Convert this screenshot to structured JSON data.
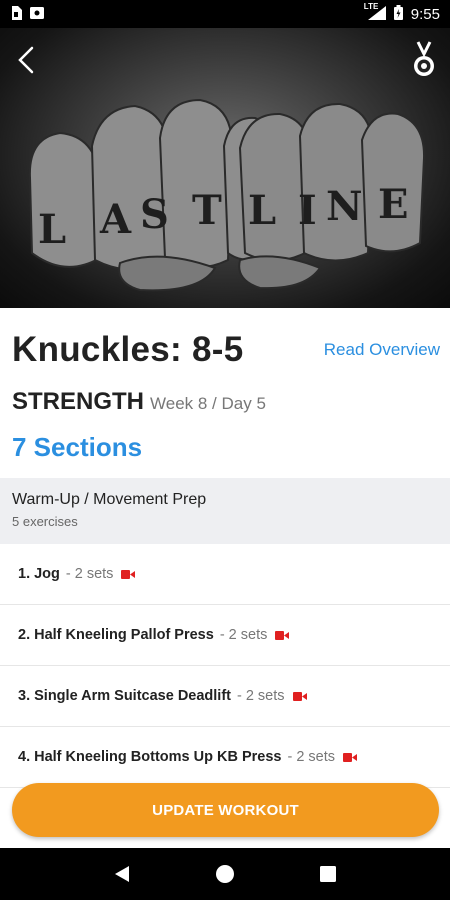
{
  "status_bar": {
    "time": "9:55",
    "network": "LTE",
    "icons": [
      "sim-card-icon",
      "storage-icon",
      "signal-icon",
      "battery-icon"
    ]
  },
  "hero": {
    "image_text": "LASTLINE",
    "back_icon": "chevron-left-icon",
    "medal_icon": "medal-icon"
  },
  "workout": {
    "title": "Knuckles: 8-5",
    "read_overview": "Read Overview",
    "category": "STRENGTH",
    "week_day": "Week 8 / Day 5",
    "sections_count": "7 Sections"
  },
  "section": {
    "name": "Warm-Up / Movement Prep",
    "subtitle": "5 exercises"
  },
  "exercises": [
    {
      "name": "1. Jog",
      "sets": "2 sets"
    },
    {
      "name": "2. Half Kneeling Pallof Press",
      "sets": "2 sets"
    },
    {
      "name": "3. Single Arm Suitcase Deadlift",
      "sets": "2 sets"
    },
    {
      "name": "4. Half Kneeling Bottoms Up KB Press",
      "sets": "2 sets"
    }
  ],
  "separator": "-",
  "update_button": {
    "label": "UPDATE WORKOUT"
  },
  "colors": {
    "accent_blue": "#2b8fe0",
    "button_orange": "#f29a1f",
    "video_red": "#e02020",
    "section_bg": "#eeeff2"
  },
  "nav": {
    "icons": [
      "back-triangle-icon",
      "home-circle-icon",
      "recents-square-icon"
    ]
  }
}
